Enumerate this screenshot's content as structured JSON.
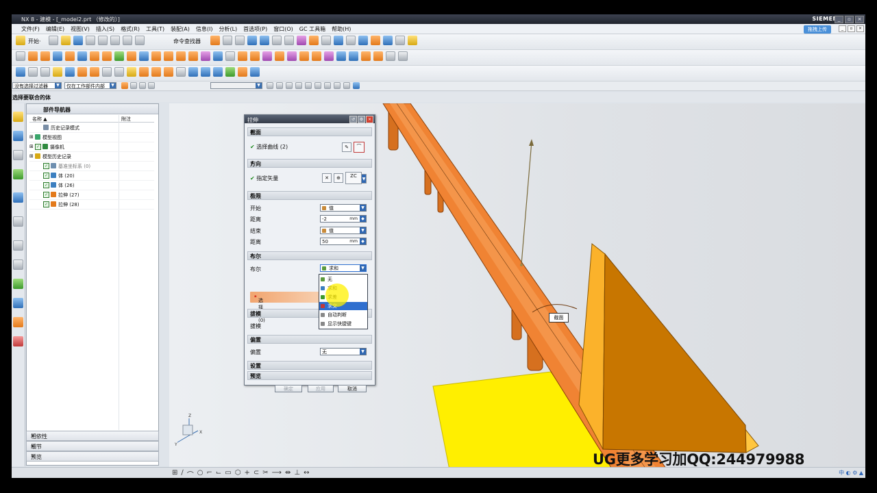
{
  "app": {
    "title": "NX 8 - 建模 - [_model2.prt （修改的）]",
    "brand": "SIEMENS",
    "cloud_label": "拖拽上传"
  },
  "menu": [
    "文件(F)",
    "编辑(E)",
    "视图(V)",
    "插入(S)",
    "格式(R)",
    "工具(T)",
    "装配(A)",
    "信息(I)",
    "分析(L)",
    "首选项(P)",
    "窗口(O)",
    "GC 工具箱",
    "帮助(H)"
  ],
  "toolbar": {
    "start_label": "开始·",
    "command_finder": "命令查找器"
  },
  "selection_bar": {
    "filter": "没有选择过滤器",
    "scope": "仅在工作部件内部"
  },
  "cue": "选择要联合的体",
  "navigator": {
    "title": "部件导航器",
    "col_name": "名称 ▲",
    "col_note": "附注",
    "rows": [
      {
        "label": "历史记录模式",
        "level": 1,
        "checked": false
      },
      {
        "label": "模型视图",
        "level": 0,
        "checked": false
      },
      {
        "label": "摄像机",
        "level": 0,
        "checked": true
      },
      {
        "label": "模型历史记录",
        "level": 0,
        "checked": false
      },
      {
        "label": "基准坐标系 (0)",
        "level": 1,
        "checked": true
      },
      {
        "label": "体 (20)",
        "level": 1,
        "checked": true
      },
      {
        "label": "体 (26)",
        "level": 1,
        "checked": true
      },
      {
        "label": "拉伸 (27)",
        "level": 1,
        "checked": true
      },
      {
        "label": "拉伸 (28)",
        "level": 1,
        "checked": true
      }
    ],
    "panels": [
      "相依性",
      "细节",
      "预览"
    ]
  },
  "dialog": {
    "title": "拉伸",
    "section": "截面",
    "select_curve": "选择曲线 (2)",
    "direction": "方向",
    "specify_vector": "指定矢量",
    "vector_value": "ZC",
    "limits": "极限",
    "start": "开始",
    "start_value": "值",
    "distance1_label": "距离",
    "distance1": "-2",
    "end": "结束",
    "end_value": "值",
    "distance2_label": "距离",
    "distance2": "50",
    "unit": "mm",
    "boolean": "布尔",
    "boolean_label": "布尔",
    "boolean_value": "求和",
    "select_body": "选择体 (0)",
    "draft": "拔模",
    "draft_label": "拔模",
    "offset": "偏置",
    "offset_label": "偏置",
    "offset_value": "无",
    "settings": "设置",
    "preview": "预览",
    "ok": "确定",
    "apply": "应用",
    "cancel": "取消"
  },
  "boolean_options": [
    "无",
    "求和",
    "求差",
    "求交",
    "自动判断",
    "显示快捷键"
  ],
  "viewport_label": "截面",
  "watermark": "UG更多学习加QQ:244979988",
  "colors": {
    "rail": "#f07f2a",
    "wall": "#c87600",
    "plane": "#ffef00",
    "accent": "#2f6fcf"
  }
}
